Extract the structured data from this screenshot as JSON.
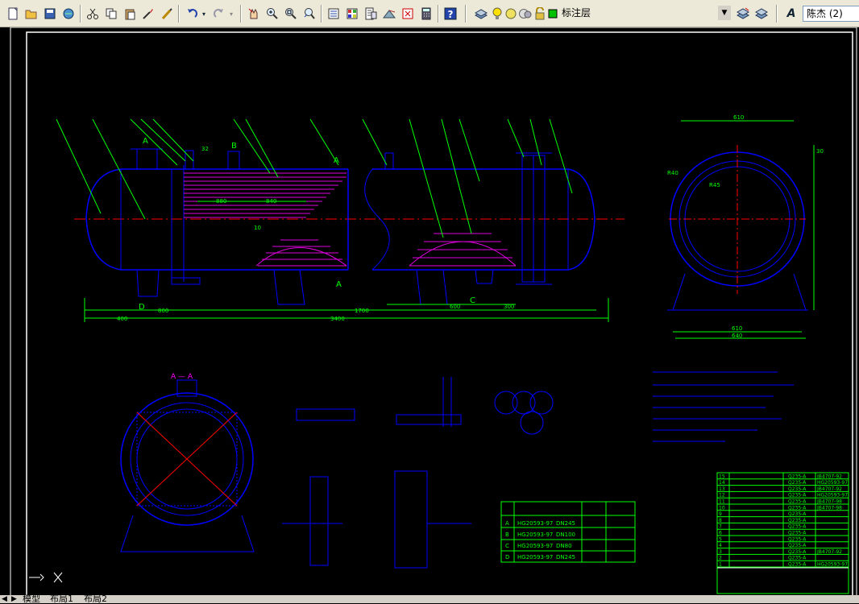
{
  "toolbar": {
    "icons": [
      "new-icon",
      "open-icon",
      "save-icon",
      "print-icon",
      "cut-icon",
      "copy-icon",
      "paste-icon",
      "matchprop-icon",
      "brush-icon",
      "undo-icon",
      "redo-icon",
      "pan-icon",
      "zoom-realtime-icon",
      "zoom-window-icon",
      "zoom-previous-icon",
      "properties-icon",
      "design-center-icon",
      "tool-palette-icon",
      "markup-icon",
      "calculator-icon",
      "help-icon"
    ],
    "layer_name": "标注层",
    "layer_icons": [
      "layer-manager-icon",
      "bulb-icon",
      "sun-icon",
      "freeze-icon",
      "lock-icon",
      "color-swatch-icon"
    ],
    "text_style_label": "A",
    "text_style_value": "陈杰 (2)",
    "colors": {
      "layer_swatch": "#00c000",
      "bulb": "#ffe000"
    }
  },
  "drawing": {
    "labels": {
      "A": "A",
      "B": "B",
      "C": "C",
      "D": "D",
      "section_aa": "A — A",
      "dim_610": "610",
      "dim_30": "30",
      "dim_880": "880",
      "dim_r40": "R40",
      "dim_r45": "R45",
      "dim_840": "840",
      "dim_800": "800",
      "dim_400": "400",
      "dim_1700": "1700",
      "dim_600": "600",
      "dim_300": "300",
      "dim_3400": "3400",
      "dim_640": "640",
      "dim_32": "32",
      "dim_10": "10"
    },
    "nozzle_table": {
      "rows": [
        {
          "id": "A",
          "std": "HG20593-97",
          "size": "DN245"
        },
        {
          "id": "B",
          "std": "HG20593-97",
          "size": "DN100"
        },
        {
          "id": "C",
          "std": "HG20593-97",
          "size": "DN80"
        },
        {
          "id": "D",
          "std": "HG20593-97",
          "size": "DN245"
        }
      ]
    },
    "bom": {
      "rows": [
        {
          "no": "15",
          "spec": "Q235-A",
          "std": "JB4707-92"
        },
        {
          "no": "14",
          "spec": "Q235-A",
          "std": "HG20593-97"
        },
        {
          "no": "13",
          "spec": "Q235-A",
          "std": "JB4707-92"
        },
        {
          "no": "12",
          "spec": "Q235-A",
          "std": "HG20593-97"
        },
        {
          "no": "11",
          "spec": "Q235-A",
          "std": "JB4707-98"
        },
        {
          "no": "10",
          "spec": "Q235-A",
          "std": "JB4707-98"
        },
        {
          "no": "9",
          "spec": "Q235-A",
          "std": ""
        },
        {
          "no": "8",
          "spec": "Q235-A",
          "std": ""
        },
        {
          "no": "7",
          "spec": "Q235-A",
          "std": ""
        },
        {
          "no": "6",
          "spec": "Q235-A",
          "std": ""
        },
        {
          "no": "5",
          "spec": "Q235-A",
          "std": ""
        },
        {
          "no": "4",
          "spec": "Q235-A",
          "std": ""
        },
        {
          "no": "3",
          "spec": "Q235-A",
          "std": "JB4707-92"
        },
        {
          "no": "2",
          "spec": "Q235-A",
          "std": ""
        },
        {
          "no": "1",
          "spec": "Q235-A",
          "std": "HG20593-97"
        }
      ]
    }
  },
  "tabs": {
    "model": "模型",
    "layout1": "布局1",
    "layout2": "布局2"
  }
}
